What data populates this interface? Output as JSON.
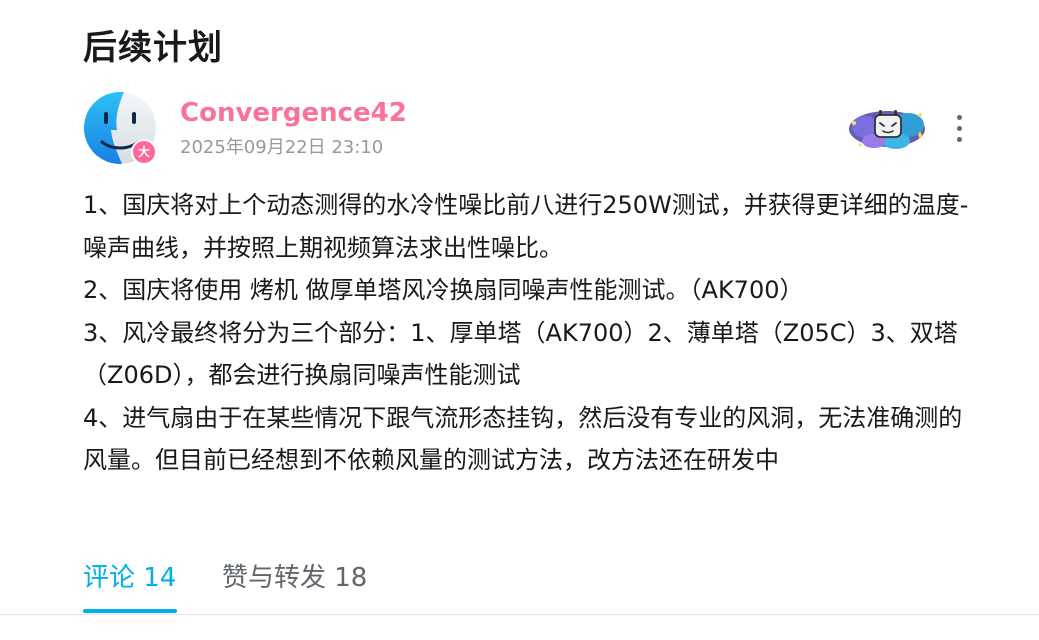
{
  "post": {
    "title": "后续计划",
    "author": {
      "name": "Convergence42",
      "badge": "大",
      "avatar_icon": "finder-face-icon"
    },
    "published_at": "2025年09月22日 23:10",
    "paragraphs": [
      "1、国庆将对上个动态测得的水冷性噪比前八进行250W测试，并获得更详细的温度-噪声曲线，并按照上期视频算法求出性噪比。",
      "2、国庆将使用 烤机 做厚单塔风冷换扇同噪声性能测试。（AK700）",
      "3、风冷最终将分为三个部分：1、厚单塔（AK700）2、薄单塔（Z05C）3、双塔（Z06D），都会进行换扇同噪声性能测试",
      "4、进气扇由于在某些情况下跟气流形态挂钩，然后没有专业的风洞，无法准确测的风量。但目前已经想到不依赖风量的测试方法，改方法还在研发中"
    ]
  },
  "tabs": {
    "comments_label": "评论 14",
    "likes_label": "赞与转发 18",
    "active": "comments"
  },
  "colors": {
    "author_name": "#fb7299",
    "accent": "#00aeec",
    "muted_text": "#9499a0",
    "badge": "#ff6699"
  }
}
